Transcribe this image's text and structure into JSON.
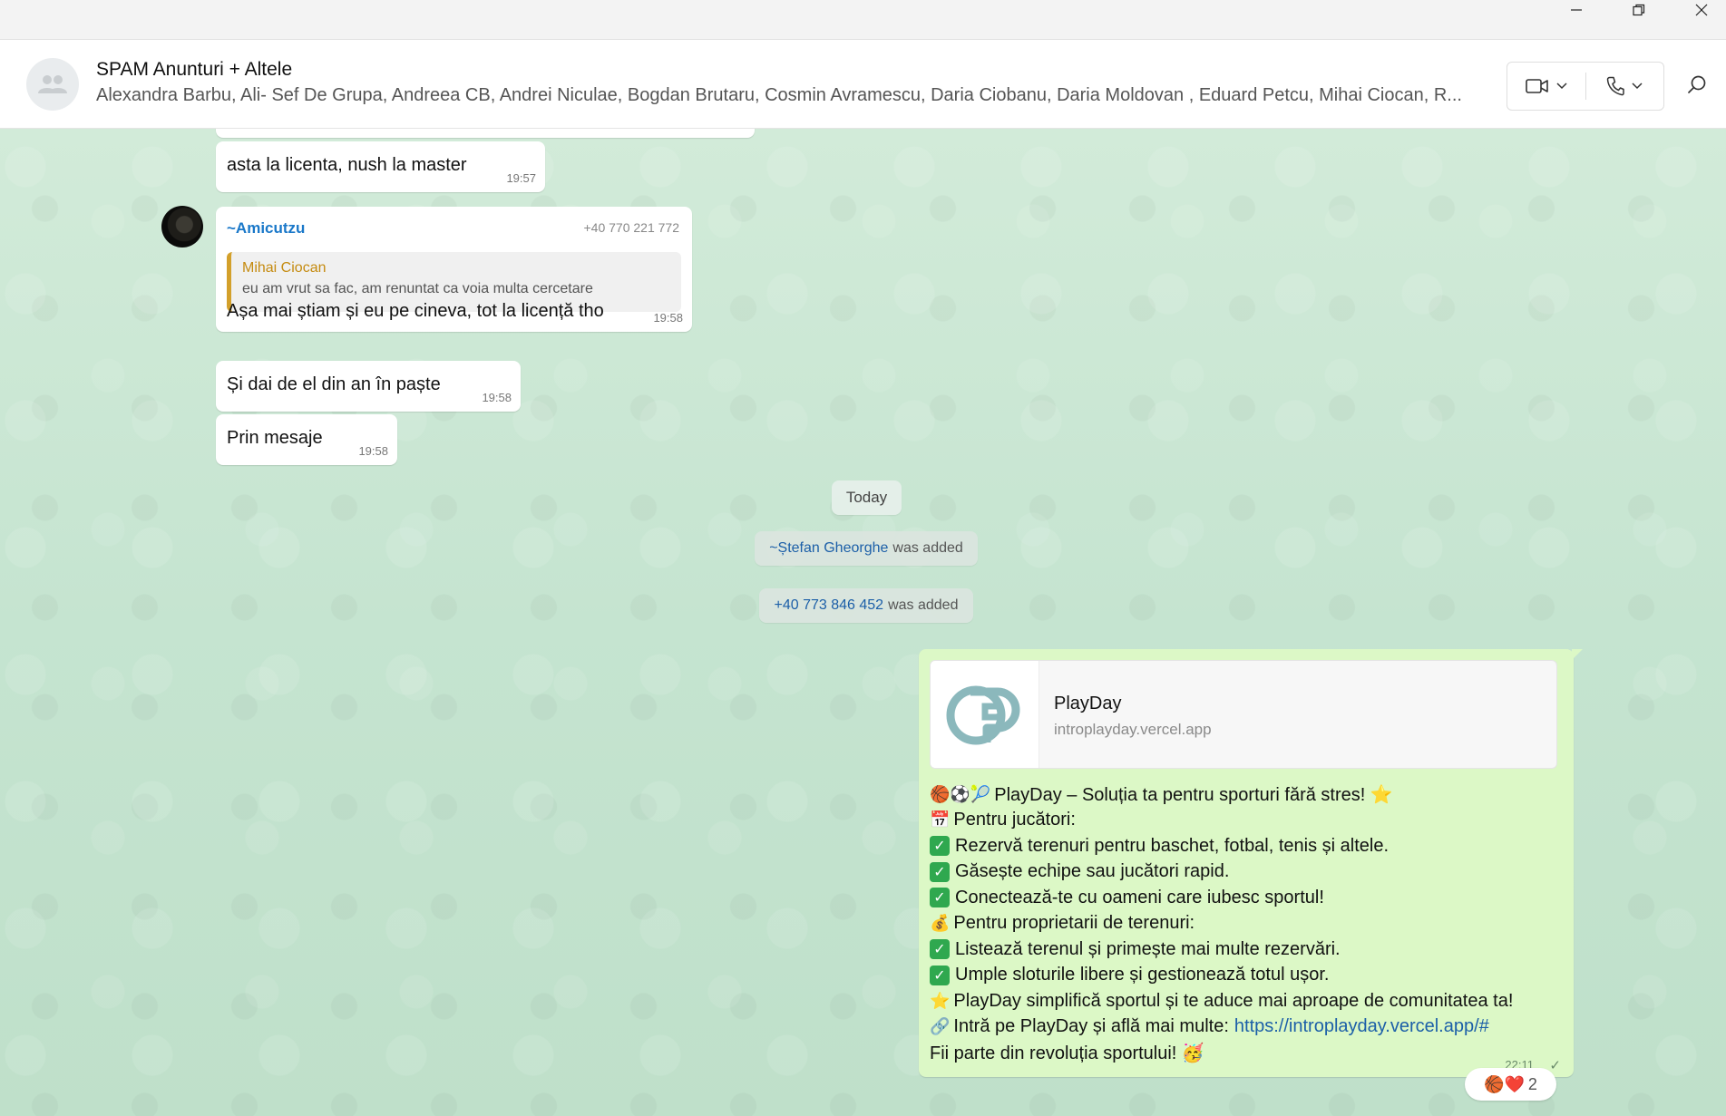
{
  "chat": {
    "title": "SPAM Anunturi + Altele",
    "members": "Alexandra Barbu, Ali- Sef De Grupa, Andreea CB, Andrei Niculae, Bogdan Brutaru, Cosmin Avramescu, Daria Ciobanu, Daria Moldovan , Eduard Petcu, Mihai Ciocan, R..."
  },
  "icons": {
    "group_avatar": "group-icon",
    "video": "video-camera-icon",
    "phone": "phone-icon",
    "search": "search-icon",
    "minimize": "minimize-icon",
    "restore": "restore-icon",
    "close": "close-icon"
  },
  "messages": {
    "m1": {
      "text": "asta la licenta, nush la master",
      "time": "19:57"
    },
    "m2": {
      "sender": "~Amicutzu",
      "phone": "+40 770 221 772",
      "quote_author": "Mihai Ciocan",
      "quote_text": "eu am vrut sa fac, am renuntat ca voia multa cercetare",
      "text": "Așa mai știam și eu pe cineva, tot la licență tho",
      "time": "19:58"
    },
    "m3": {
      "text": "Și dai de el din an în paște",
      "time": "19:58"
    },
    "m4": {
      "text": "Prin mesaje",
      "time": "19:58"
    }
  },
  "date_divider": "Today",
  "system": {
    "s1_name": "~Ștefan Gheorghe",
    "s1_text": "was added",
    "s2_name": "+40 773 846 452",
    "s2_text": "was added"
  },
  "outgoing": {
    "preview_title": "PlayDay",
    "preview_url": "introplayday.vercel.app",
    "lines": [
      {
        "icon": "🏀⚽🎾",
        "text": "PlayDay – Soluția ta pentru sporturi fără stres! ⭐"
      },
      {
        "icon": "📅",
        "text": "Pentru jucători:"
      },
      {
        "icon": "check",
        "text": "Rezervă terenuri pentru baschet, fotbal, tenis și altele."
      },
      {
        "icon": "check",
        "text": "Găsește echipe sau jucători rapid."
      },
      {
        "icon": "check",
        "text": "Conectează-te cu oameni care iubesc sportul!"
      },
      {
        "icon": "💰",
        "text": "Pentru proprietarii de terenuri:"
      },
      {
        "icon": "check",
        "text": "Listează terenul și primește mai multe rezervări."
      },
      {
        "icon": "check",
        "text": "Umple sloturile libere și gestionează totul ușor."
      },
      {
        "icon": "⭐",
        "text": "PlayDay simplifică sportul și te aduce mai aproape de comunitatea ta!"
      },
      {
        "icon": "🔗",
        "text": "Intră pe PlayDay și află mai multe:",
        "link": "https://introplayday.vercel.app/#"
      },
      {
        "icon": "",
        "text": "Fii parte din revoluția sportului! 🥳"
      }
    ],
    "time": "22:11",
    "status": "✓",
    "reactions": "🏀❤️",
    "reaction_count": "2"
  }
}
